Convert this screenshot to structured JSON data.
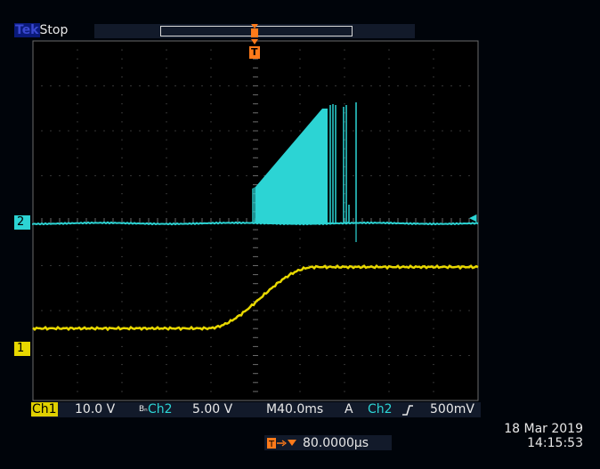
{
  "header": {
    "brand": "Tek",
    "status": "Stop"
  },
  "markers": {
    "ch2_marker": "2",
    "ch1_marker": "1",
    "trigger_marker": "T"
  },
  "readouts": {
    "ch1_label": "Ch1",
    "ch1_scale": "10.0 V",
    "bw_symbol": "Bₙ",
    "ch2_label": "Ch2",
    "ch2_scale": "5.00 V",
    "timebase_label": "M",
    "timebase": "40.0ms",
    "trigger_mode": "A",
    "trigger_source": "Ch2",
    "trigger_slope_symbol": "ʃ",
    "trigger_level": "500mV",
    "trigger_position": "80.0000µs",
    "trigger_position_icon": "T→▼"
  },
  "datetime": {
    "date": "18 Mar 2019",
    "time": "14:15:53"
  },
  "colors": {
    "ch1": "#e8d800",
    "ch2": "#2cd4d4",
    "trigger": "#ff7a1a",
    "grid": "#6a6a6a",
    "background": "#000000"
  },
  "icons": {
    "trigger_slope": "rising-edge-icon",
    "trigger_position": "trigger-position-icon"
  }
}
